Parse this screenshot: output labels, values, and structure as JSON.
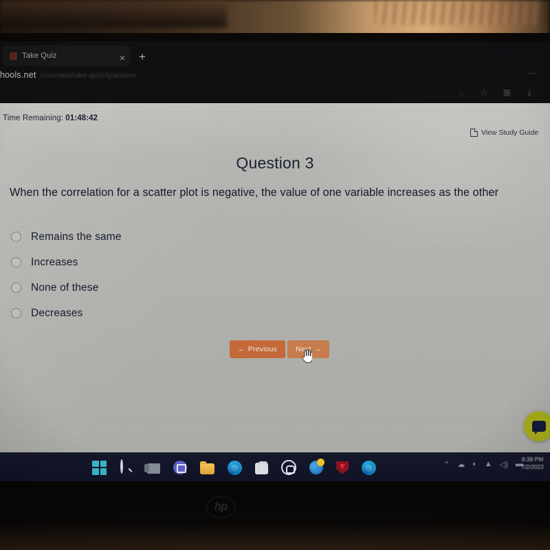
{
  "browser": {
    "tab": {
      "title": "Take Quiz",
      "favicon_icon": "site-favicon",
      "close_icon": "×",
      "newtab_icon": "+"
    },
    "window_controls": {
      "minimize_icon": "—"
    },
    "address_bar": {
      "url": "hools.net",
      "path": "/courses/take-quiz/question"
    },
    "toolbar_icons": [
      {
        "name": "read-aloud-icon",
        "glyph": "◌"
      },
      {
        "name": "favorites-icon",
        "glyph": "☆"
      },
      {
        "name": "collections-icon",
        "glyph": "⊞"
      },
      {
        "name": "downloads-icon",
        "glyph": "⤓"
      }
    ]
  },
  "quiz": {
    "timer_label": "Time Remaining:",
    "timer_value": "01:48:42",
    "study_guide_label": "View Study Guide",
    "study_guide_icon": "external-window-icon",
    "question_title": "Question 3",
    "question_text": "When the correlation for a scatter plot is negative, the value of one variable increases as the other",
    "options": [
      {
        "label": "Remains the same",
        "selected": false
      },
      {
        "label": "Increases",
        "selected": false
      },
      {
        "label": "None of these",
        "selected": false
      },
      {
        "label": "Decreases",
        "selected": false
      }
    ],
    "previous_button": "Previous",
    "previous_arrow": "←",
    "next_button": "Next",
    "next_arrow": "→",
    "chat_widget_icon": "chat-bubble-icon"
  },
  "colors": {
    "button_primary": "#c3693a",
    "button_hover": "#c67c4c",
    "page_background": "#b5b6b2",
    "chat_widget": "#a8ac1a",
    "taskbar": "#13162a"
  },
  "taskbar": {
    "items": [
      {
        "name": "start-button-icon",
        "label": "Start"
      },
      {
        "name": "search-icon",
        "label": "Search"
      },
      {
        "name": "task-view-icon",
        "label": "Task View"
      },
      {
        "name": "microsoft-teams-icon",
        "label": "Chat"
      },
      {
        "name": "file-explorer-icon",
        "label": "File Explorer"
      },
      {
        "name": "microsoft-edge-icon",
        "label": "Microsoft Edge"
      },
      {
        "name": "microsoft-store-icon",
        "label": "Microsoft Store"
      },
      {
        "name": "headphones-icon",
        "label": "Audio App"
      },
      {
        "name": "globe-browser-icon",
        "label": "Browser"
      },
      {
        "name": "mcafee-shield-icon",
        "label": "McAfee"
      },
      {
        "name": "microsoft-edge-icon-2",
        "label": "Microsoft Edge"
      }
    ],
    "tray": [
      {
        "name": "show-hidden-icons-chevron",
        "glyph": "⌃"
      },
      {
        "name": "cloud-icon",
        "glyph": "☁"
      },
      {
        "name": "onedrive-sync-icon",
        "glyph": "◐"
      },
      {
        "name": "wifi-icon",
        "glyph": "▲"
      },
      {
        "name": "volume-icon",
        "glyph": "◁)"
      },
      {
        "name": "battery-icon",
        "glyph": "▬"
      }
    ],
    "clock_time": "8:38 PM",
    "clock_date": "7/2/2022"
  },
  "device": {
    "brand_logo": "hp"
  }
}
